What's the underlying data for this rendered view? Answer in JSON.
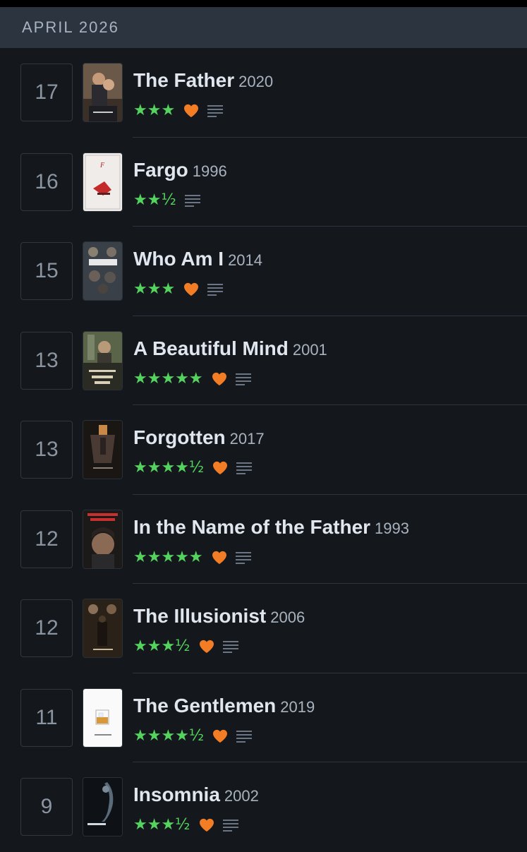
{
  "month": "APRIL 2026",
  "colors": {
    "stars": "#54d35e",
    "heart": "#f27d24",
    "review": "#6b7684"
  },
  "entries": [
    {
      "day": "17",
      "title": "The Father",
      "year": "2020",
      "rating": "★★★",
      "liked": true,
      "review": true,
      "poster_icon": "poster-the-father"
    },
    {
      "day": "16",
      "title": "Fargo",
      "year": "1996",
      "rating": "★★½",
      "liked": false,
      "review": true,
      "poster_icon": "poster-fargo"
    },
    {
      "day": "15",
      "title": "Who Am I",
      "year": "2014",
      "rating": "★★★",
      "liked": true,
      "review": true,
      "poster_icon": "poster-who-am-i"
    },
    {
      "day": "13",
      "title": "A Beautiful Mind",
      "year": "2001",
      "rating": "★★★★★",
      "liked": true,
      "review": true,
      "poster_icon": "poster-a-beautiful-mind"
    },
    {
      "day": "13",
      "title": "Forgotten",
      "year": "2017",
      "rating": "★★★★½",
      "liked": true,
      "review": true,
      "poster_icon": "poster-forgotten"
    },
    {
      "day": "12",
      "title": "In the Name of the Father",
      "year": "1993",
      "rating": "★★★★★",
      "liked": true,
      "review": true,
      "poster_icon": "poster-in-the-name-of-the-father"
    },
    {
      "day": "12",
      "title": "The Illusionist",
      "year": "2006",
      "rating": "★★★½",
      "liked": true,
      "review": true,
      "poster_icon": "poster-the-illusionist"
    },
    {
      "day": "11",
      "title": "The Gentlemen",
      "year": "2019",
      "rating": "★★★★½",
      "liked": true,
      "review": true,
      "poster_icon": "poster-the-gentlemen"
    },
    {
      "day": "9",
      "title": "Insomnia",
      "year": "2002",
      "rating": "★★★½",
      "liked": true,
      "review": true,
      "poster_icon": "poster-insomnia"
    }
  ]
}
